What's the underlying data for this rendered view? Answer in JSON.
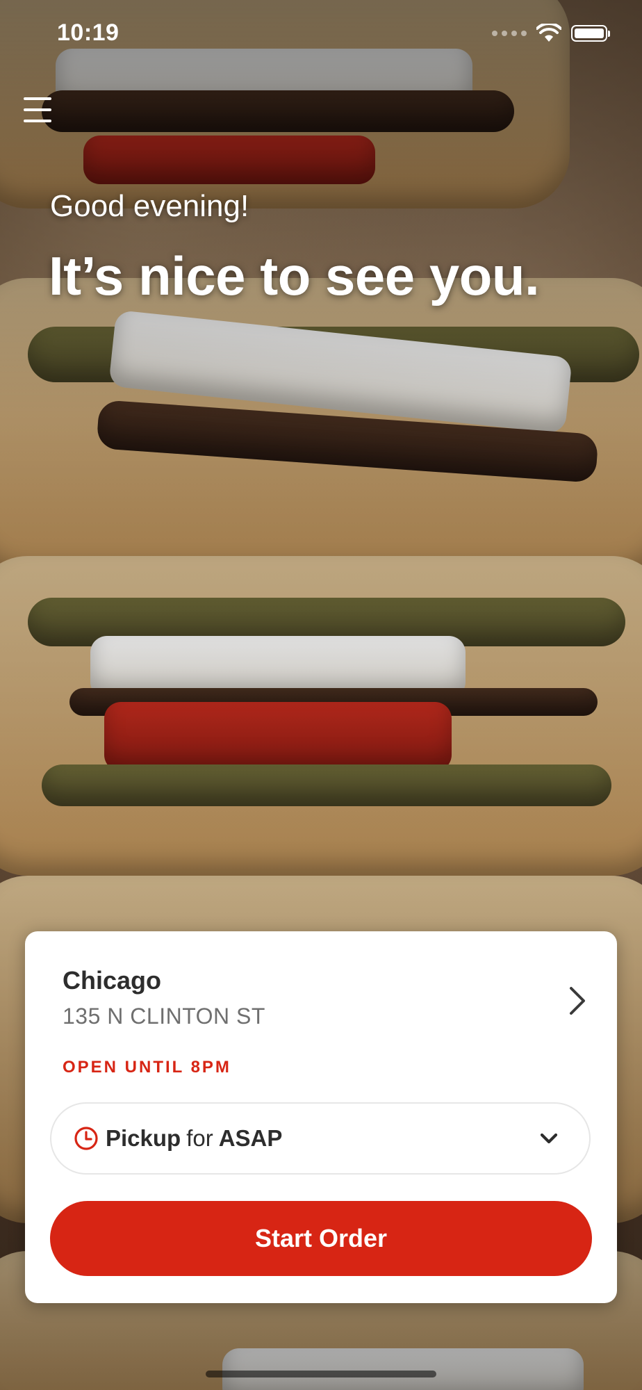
{
  "status_bar": {
    "time": "10:19",
    "icons": [
      "signal-icon",
      "wifi-icon",
      "battery-icon"
    ]
  },
  "header": {
    "menu_icon": "hamburger-menu-icon",
    "greeting": "Good evening!",
    "headline": "It’s nice to see you."
  },
  "location": {
    "city": "Chicago",
    "address": "135 N CLINTON ST",
    "hours": "OPEN UNTIL 8PM",
    "chevron_icon": "chevron-right-icon"
  },
  "order_options": {
    "mode": "Pickup",
    "connector": "for",
    "time": "ASAP",
    "clock_icon": "clock-icon",
    "dropdown_icon": "chevron-down-icon"
  },
  "actions": {
    "start_order": "Start Order"
  },
  "colors": {
    "accent": "#D72514",
    "card": "#FFFFFF",
    "text_primary": "#2D2D2D",
    "text_secondary": "#6F6F6F"
  }
}
